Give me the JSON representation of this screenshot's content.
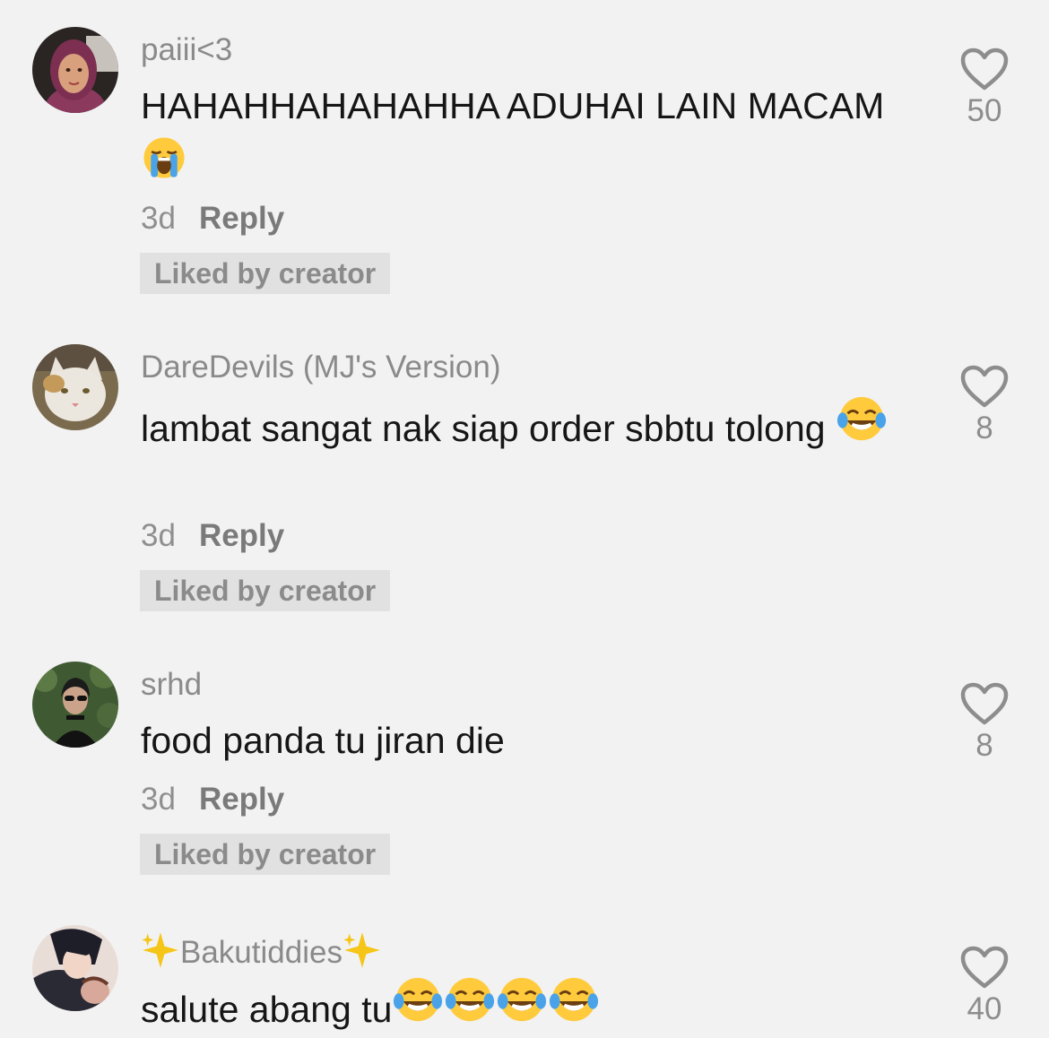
{
  "comments": [
    {
      "username": "paiii<3",
      "text": "HAHAHHAHAHAHHA ADUHAI LAIN MACAM",
      "emoji": "loudly-crying-face",
      "time": "3d",
      "reply_label": "Reply",
      "badge": "Liked by creator",
      "likes": "50"
    },
    {
      "username": "DareDevils (MJ's Version)",
      "text": "lambat sangat nak siap order sbbtu tolong",
      "emoji": "face-with-tears-of-joy",
      "time": "3d",
      "reply_label": "Reply",
      "badge": "Liked by creator",
      "likes": "8"
    },
    {
      "username": "srhd",
      "text": "food panda tu jiran die",
      "time": "3d",
      "reply_label": "Reply",
      "badge": "Liked by creator",
      "likes": "8"
    },
    {
      "username": "Bakutiddies",
      "username_decoration": "sparkles",
      "text": "salute abang tu",
      "emoji": "face-with-tears-of-joy x4",
      "likes": "40"
    }
  ],
  "colors": {
    "background": "#f2f2f2",
    "text": "#161616",
    "muted": "#8a8a8a",
    "badge_bg": "#e1e1e1"
  },
  "icons": [
    "heart-outline-icon"
  ]
}
